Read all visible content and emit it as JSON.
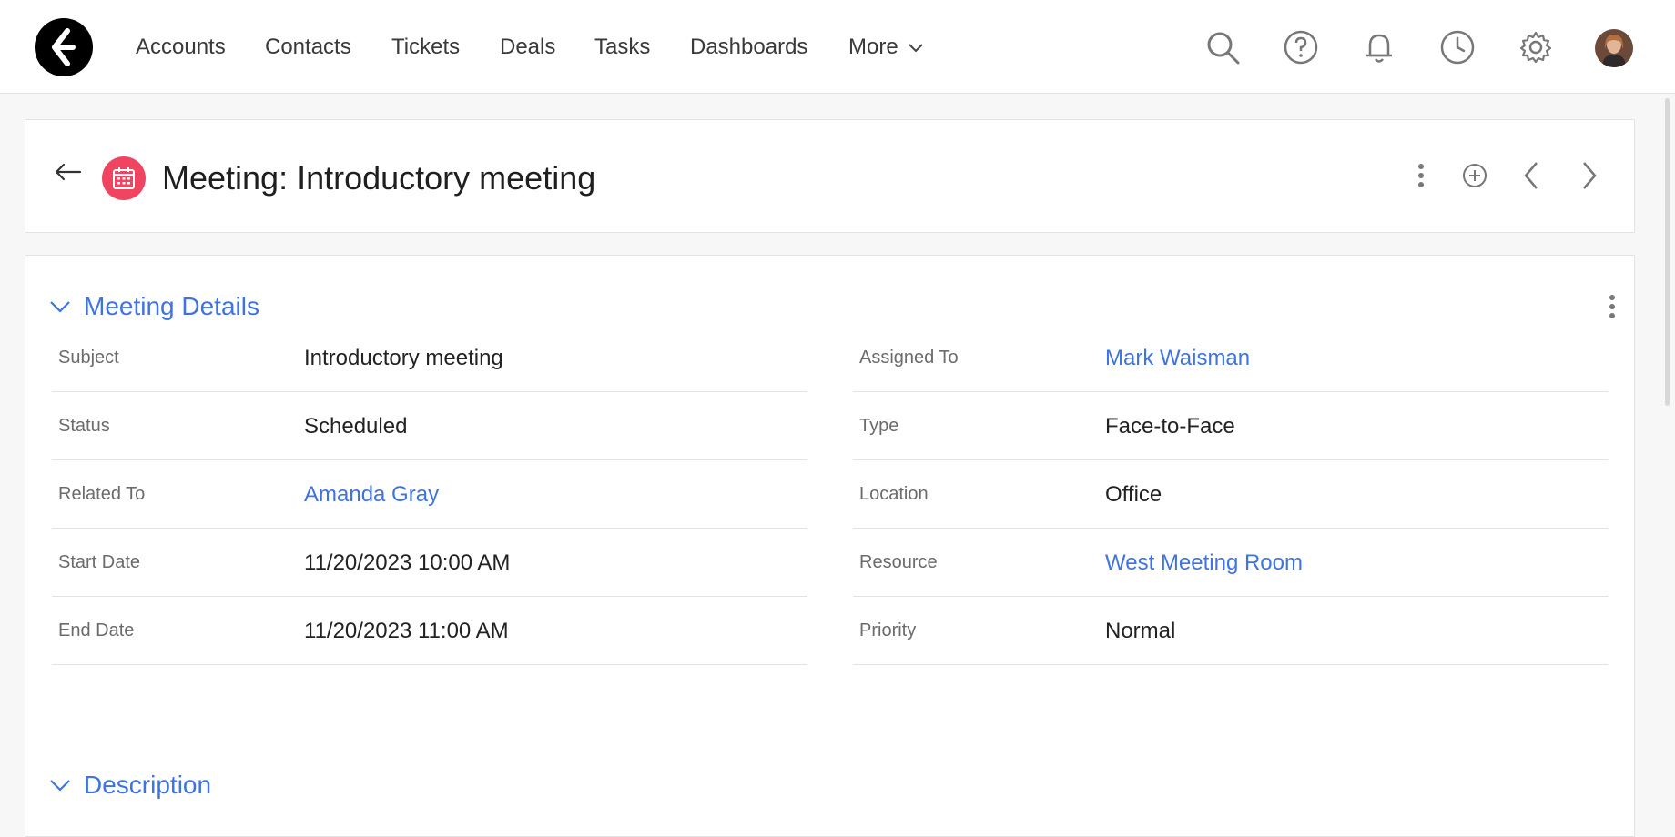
{
  "nav": {
    "items": [
      "Accounts",
      "Contacts",
      "Tickets",
      "Deals",
      "Tasks",
      "Dashboards"
    ],
    "more_label": "More"
  },
  "record": {
    "title": "Meeting: Introductory meeting"
  },
  "sections": {
    "details_title": "Meeting Details",
    "description_title": "Description"
  },
  "fields": {
    "left": [
      {
        "label": "Subject",
        "value": "Introductory meeting"
      },
      {
        "label": "Status",
        "value": "Scheduled"
      },
      {
        "label": "Related To",
        "value": "Amanda Gray"
      },
      {
        "label": "Start Date",
        "value": "11/20/2023 10:00 AM"
      },
      {
        "label": "End Date",
        "value": "11/20/2023 11:00 AM"
      }
    ],
    "right": [
      {
        "label": "Assigned To",
        "value": "Mark Waisman"
      },
      {
        "label": "Type",
        "value": "Face-to-Face"
      },
      {
        "label": "Location",
        "value": "Office"
      },
      {
        "label": "Resource",
        "value": "West Meeting Room"
      },
      {
        "label": "Priority",
        "value": "Normal"
      }
    ]
  },
  "icons": {
    "top": [
      "search-icon",
      "help-icon",
      "bell-icon",
      "history-icon",
      "gear-icon"
    ],
    "header": [
      "more-vertical-icon",
      "add-circle-icon",
      "chevron-left-icon",
      "chevron-right-icon"
    ]
  },
  "colors": {
    "link": "#3f73e0",
    "module_badge": "#ef4561"
  }
}
